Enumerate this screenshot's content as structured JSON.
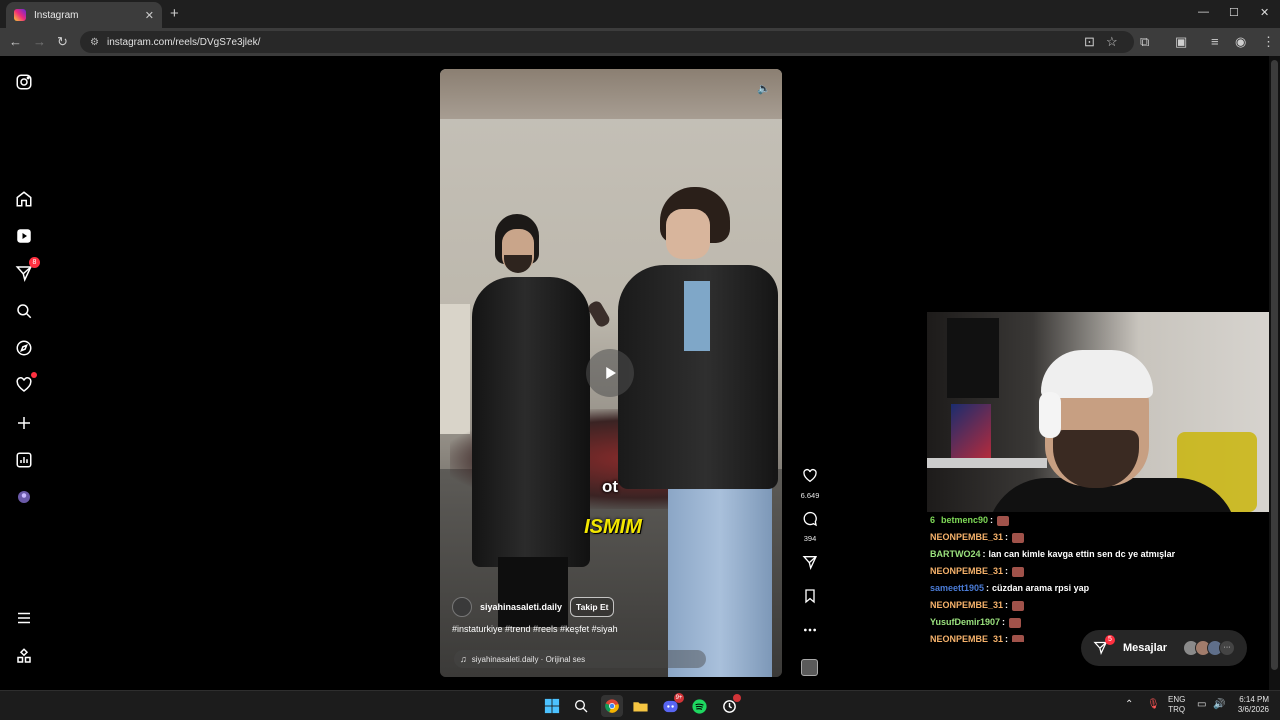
{
  "browser": {
    "tab_title": "Instagram",
    "tab_close": "✕",
    "new_tab": "+",
    "url": "instagram.com/reels/DVgS7e3jlek/",
    "window_controls": [
      "—",
      "☐",
      "✕"
    ]
  },
  "sidebar": {
    "notifications_badge": "8"
  },
  "reel": {
    "caption_line_1": "ot",
    "caption_line_2": "ISMIM",
    "username": "siyahinasaleti.daily",
    "follow_label": "Takip Et",
    "description": "#instaturkiye #trend #reels #keşfet #siyah",
    "audio": "siyahinasaleti.daily · Orijinal ses"
  },
  "actions": {
    "likes": "6.649",
    "comments": "394"
  },
  "chat": [
    {
      "user": "betmenc90",
      "prefix": "6",
      "color": "#7ed957",
      "message": "",
      "emote": true
    },
    {
      "user": "NEONPEMBE_31",
      "color": "#f6b26b",
      "message": "",
      "emote": true
    },
    {
      "user": "BARTWO24",
      "color": "#9be27e",
      "message": "lan can kimle kavga ettin sen dc ye atmışlar",
      "emote": false
    },
    {
      "user": "NEONPEMBE_31",
      "color": "#f6b26b",
      "message": "",
      "emote": true
    },
    {
      "user": "sameett1905",
      "color": "#4a7bd6",
      "message": "cüzdan arama rpsi yap",
      "emote": false
    },
    {
      "user": "NEONPEMBE_31",
      "color": "#f6b26b",
      "message": "",
      "emote": true
    },
    {
      "user": "YusufDemir1907",
      "color": "#9be27e",
      "message": "",
      "emote": true
    },
    {
      "user": "NEONPEMBE_31",
      "color": "#f6b26b",
      "message": "",
      "emote": true
    }
  ],
  "messages": {
    "label": "Mesajlar",
    "badge": "5"
  },
  "taskbar": {
    "discord_badge": "9+",
    "lang_top": "ENG",
    "lang_bottom": "TRQ",
    "time": "6:14 PM",
    "date": "3/6/2026"
  }
}
